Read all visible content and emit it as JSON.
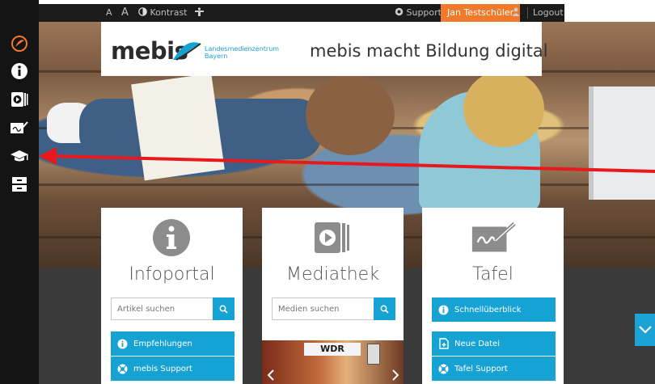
{
  "topbar": {
    "font_smaller": "A",
    "font_larger": "A",
    "contrast": "Kontrast",
    "support": "Support",
    "user": "Jan Testschüler",
    "logout": "Logout"
  },
  "logo": {
    "name": "mebis",
    "subtitle_line1": "Landesmedienzentrum",
    "subtitle_line2": "Bayern"
  },
  "tagline": "mebis macht Bildung digital",
  "cards": {
    "infoportal": {
      "title": "Infoportal",
      "search_placeholder": "Artikel suchen",
      "items": [
        "Empfehlungen",
        "mebis Support"
      ]
    },
    "mediathek": {
      "title": "Mediathek",
      "search_placeholder": "Medien suchen",
      "thumb_label": "WDR"
    },
    "tafel": {
      "title": "Tafel",
      "items": [
        "Schnellüberblick",
        "Neue Datei",
        "Tafel Support"
      ]
    }
  },
  "sidebar": {
    "icons": [
      "mebis-logo-icon",
      "info-icon",
      "mediathek-icon",
      "tafel-icon",
      "lernplattform-icon",
      "pruefungsarchiv-icon"
    ]
  },
  "colors": {
    "accent": "#16a3d3",
    "user_badge": "#f07a2a",
    "arrow": "#e8191c",
    "sidebar": "#141414"
  }
}
